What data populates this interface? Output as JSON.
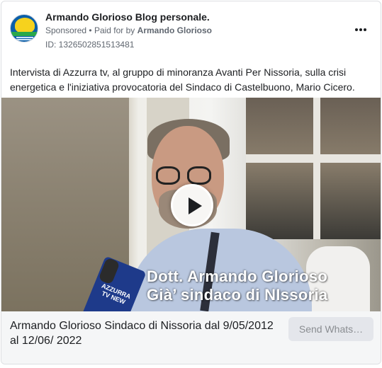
{
  "header": {
    "page_name": "Armando Glorioso Blog personale.",
    "sponsored_label": "Sponsored",
    "separator": "•",
    "paid_for_prefix": "Paid for by",
    "paid_for_name": "Armando Glorioso",
    "ad_id": "ID: 1326502851513481",
    "more_icon": "more-horizontal-icon"
  },
  "body": {
    "text": "Intervista di Azzurra tv, al gruppo di minoranza Avanti Per Nissoria, sulla crisi energetica e l'iniziativa provocatoria del Sindaco di Castelbuono, Mario Cicero."
  },
  "video": {
    "caption_line1": "Dott. Armando Glorioso",
    "caption_line2": "Già’  sindaco di NIssoria",
    "mic_label": "AZZURRA TV NEW",
    "play_icon": "play-icon"
  },
  "footer": {
    "title": "Armando Glorioso Sindaco di Nissoria dal 9/05/2012 al 12/06/ 2022",
    "cta_label": "Send Whats…"
  }
}
